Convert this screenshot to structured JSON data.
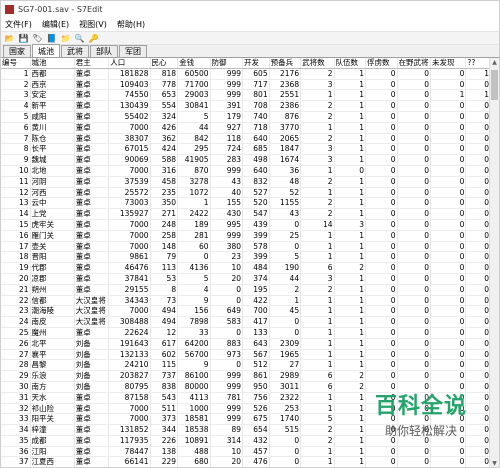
{
  "window": {
    "title": "SG7-001.sav - S7Edit"
  },
  "menu": [
    "文件(F)",
    "编辑(E)",
    "视图(V)",
    "帮助(H)"
  ],
  "toolbar": {
    "icons": [
      "open-icon",
      "save-icon",
      "tag-icon",
      "book-icon",
      "folder-icon",
      "search-icon",
      "key-icon"
    ]
  },
  "tabs": [
    "国家",
    "城池",
    "武将",
    "部队",
    "军团"
  ],
  "active_tab": 1,
  "columns": [
    "编号",
    "城池",
    "君主",
    "人口",
    "民心",
    "金钱",
    "防御",
    "开发",
    "预备兵",
    "武将数",
    "队伍数",
    "俘虏数",
    "在野武将",
    "未发现",
    "??"
  ],
  "rows": [
    [
      "1",
      "西都",
      "董卓",
      "181828",
      "818",
      "60500",
      "999",
      "605",
      "2176",
      "2",
      "1",
      "0",
      "0",
      "0",
      "1"
    ],
    [
      "2",
      "西京",
      "董卓",
      "109403",
      "778",
      "71700",
      "999",
      "717",
      "2368",
      "3",
      "1",
      "0",
      "0",
      "0",
      "0"
    ],
    [
      "3",
      "安定",
      "董卓",
      "74550",
      "653",
      "29003",
      "999",
      "801",
      "2551",
      "1",
      "1",
      "0",
      "0",
      "1",
      "1"
    ],
    [
      "4",
      "新平",
      "董卓",
      "130439",
      "554",
      "30841",
      "391",
      "708",
      "2386",
      "2",
      "1",
      "0",
      "0",
      "0",
      "0"
    ],
    [
      "5",
      "咸阳",
      "董卓",
      "55402",
      "324",
      "5",
      "179",
      "740",
      "876",
      "2",
      "1",
      "0",
      "0",
      "0",
      "0"
    ],
    [
      "6",
      "黄川",
      "董卓",
      "7000",
      "426",
      "44",
      "927",
      "718",
      "3770",
      "1",
      "1",
      "0",
      "0",
      "0",
      "0"
    ],
    [
      "7",
      "陈仓",
      "董卓",
      "38307",
      "362",
      "842",
      "118",
      "640",
      "2065",
      "2",
      "1",
      "0",
      "0",
      "0",
      "0"
    ],
    [
      "8",
      "长平",
      "董卓",
      "67015",
      "424",
      "295",
      "724",
      "685",
      "1847",
      "3",
      "1",
      "0",
      "0",
      "0",
      "0"
    ],
    [
      "9",
      "魏城",
      "董卓",
      "90069",
      "588",
      "41905",
      "283",
      "498",
      "1674",
      "3",
      "1",
      "0",
      "0",
      "0",
      "0"
    ],
    [
      "10",
      "北地",
      "董卓",
      "7000",
      "316",
      "870",
      "999",
      "640",
      "36",
      "1",
      "0",
      "0",
      "0",
      "0",
      "0"
    ],
    [
      "11",
      "河阴",
      "董卓",
      "37539",
      "458",
      "3278",
      "43",
      "832",
      "48",
      "2",
      "1",
      "0",
      "0",
      "0",
      "0"
    ],
    [
      "12",
      "河西",
      "董卓",
      "25572",
      "235",
      "1072",
      "40",
      "527",
      "52",
      "1",
      "1",
      "0",
      "0",
      "0",
      "0"
    ],
    [
      "13",
      "云中",
      "董卓",
      "73003",
      "350",
      "1",
      "155",
      "520",
      "1155",
      "2",
      "1",
      "0",
      "0",
      "0",
      "0"
    ],
    [
      "14",
      "上党",
      "董卓",
      "135927",
      "271",
      "2422",
      "430",
      "547",
      "43",
      "2",
      "1",
      "0",
      "0",
      "0",
      "0"
    ],
    [
      "15",
      "虎牢关",
      "董卓",
      "7000",
      "248",
      "189",
      "995",
      "439",
      "0",
      "14",
      "3",
      "0",
      "0",
      "0",
      "0"
    ],
    [
      "16",
      "雁门关",
      "董卓",
      "7000",
      "258",
      "281",
      "999",
      "399",
      "25",
      "1",
      "1",
      "0",
      "0",
      "0",
      "0"
    ],
    [
      "17",
      "壶关",
      "董卓",
      "7000",
      "148",
      "60",
      "380",
      "578",
      "0",
      "1",
      "1",
      "0",
      "0",
      "0",
      "0"
    ],
    [
      "18",
      "晋阳",
      "董卓",
      "9861",
      "79",
      "0",
      "23",
      "399",
      "5",
      "1",
      "1",
      "0",
      "0",
      "0",
      "0"
    ],
    [
      "19",
      "代郡",
      "董卓",
      "46476",
      "113",
      "4136",
      "10",
      "484",
      "190",
      "6",
      "2",
      "0",
      "0",
      "0",
      "0"
    ],
    [
      "20",
      "凉郡",
      "董卓",
      "37841",
      "53",
      "5",
      "20",
      "374",
      "44",
      "3",
      "1",
      "0",
      "0",
      "0",
      "0"
    ],
    [
      "21",
      "朔州",
      "董卓",
      "29155",
      "8",
      "4",
      "0",
      "195",
      "2",
      "2",
      "1",
      "0",
      "0",
      "0",
      "0"
    ],
    [
      "22",
      "信都",
      "大汉皇将",
      "34343",
      "73",
      "9",
      "0",
      "422",
      "1",
      "1",
      "1",
      "0",
      "0",
      "0",
      "0"
    ],
    [
      "23",
      "潮海陵",
      "大汉皇将",
      "7000",
      "494",
      "156",
      "649",
      "700",
      "45",
      "1",
      "1",
      "0",
      "0",
      "0",
      "0"
    ],
    [
      "24",
      "南皮",
      "大汉皇将",
      "308488",
      "494",
      "7898",
      "583",
      "417",
      "0",
      "1",
      "1",
      "0",
      "0",
      "0",
      "0"
    ],
    [
      "25",
      "魔州",
      "董卓",
      "22624",
      "12",
      "33",
      "0",
      "133",
      "0",
      "1",
      "1",
      "0",
      "0",
      "0",
      "0"
    ],
    [
      "26",
      "北平",
      "刘备",
      "191643",
      "617",
      "64200",
      "883",
      "643",
      "2309",
      "1",
      "1",
      "0",
      "0",
      "0",
      "0"
    ],
    [
      "27",
      "襄平",
      "刘备",
      "132133",
      "602",
      "56700",
      "973",
      "567",
      "1965",
      "1",
      "1",
      "0",
      "0",
      "0",
      "0"
    ],
    [
      "28",
      "昌黎",
      "刘备",
      "24210",
      "115",
      "9",
      "0",
      "512",
      "27",
      "1",
      "1",
      "0",
      "0",
      "0",
      "0"
    ],
    [
      "29",
      "乐浪",
      "刘备",
      "203827",
      "737",
      "86100",
      "999",
      "861",
      "2989",
      "6",
      "2",
      "0",
      "0",
      "0",
      "0"
    ],
    [
      "30",
      "南方",
      "刘备",
      "80795",
      "838",
      "80000",
      "999",
      "950",
      "3011",
      "6",
      "2",
      "0",
      "0",
      "0",
      "0"
    ],
    [
      "31",
      "天水",
      "董卓",
      "87158",
      "543",
      "4113",
      "781",
      "756",
      "2322",
      "1",
      "1",
      "0",
      "0",
      "0",
      "0"
    ],
    [
      "32",
      "祁山险",
      "董卓",
      "7000",
      "511",
      "1000",
      "999",
      "526",
      "253",
      "1",
      "1",
      "0",
      "0",
      "0",
      "0"
    ],
    [
      "33",
      "阳平关",
      "董卓",
      "7000",
      "373",
      "18581",
      "999",
      "675",
      "1740",
      "5",
      "1",
      "0",
      "0",
      "0",
      "0"
    ],
    [
      "34",
      "梓潼",
      "董卓",
      "131852",
      "344",
      "18538",
      "89",
      "654",
      "515",
      "2",
      "1",
      "0",
      "0",
      "0",
      "0"
    ],
    [
      "35",
      "成都",
      "董卓",
      "117935",
      "226",
      "10891",
      "314",
      "432",
      "0",
      "2",
      "1",
      "0",
      "0",
      "0",
      "0"
    ],
    [
      "36",
      "江阳",
      "董卓",
      "78447",
      "138",
      "488",
      "10",
      "457",
      "0",
      "1",
      "1",
      "0",
      "0",
      "0",
      "0"
    ],
    [
      "37",
      "江夏西",
      "董卓",
      "66141",
      "229",
      "680",
      "20",
      "476",
      "0",
      "1",
      "1",
      "0",
      "0",
      "0",
      "0"
    ]
  ],
  "watermark": {
    "title": "百科全说",
    "subtitle": "助你轻松解决"
  }
}
